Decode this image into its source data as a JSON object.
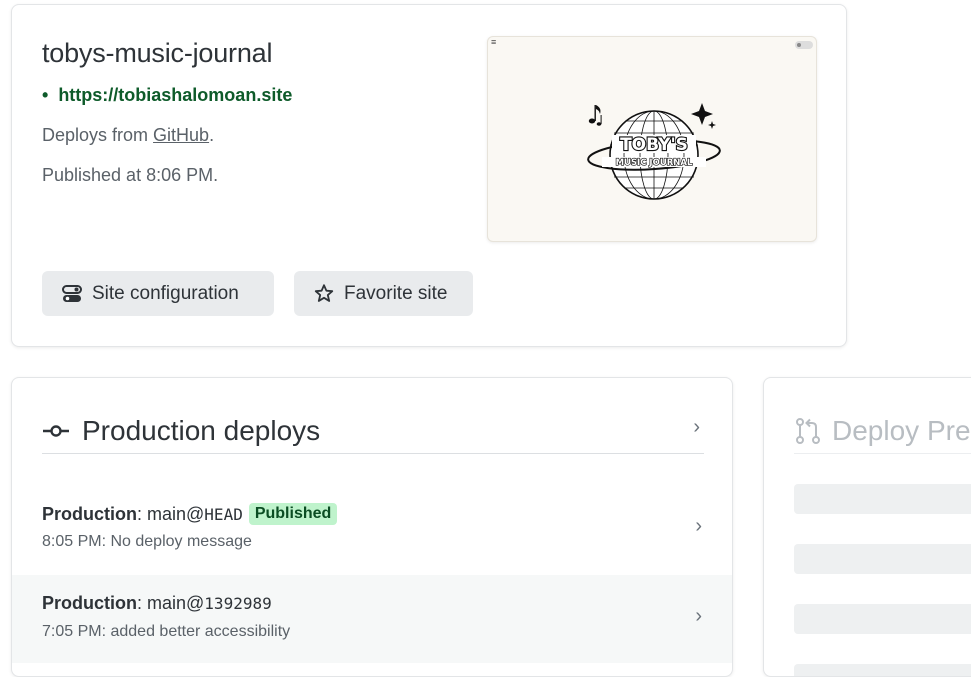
{
  "site": {
    "name": "tobys-music-journal",
    "url": "https://tobiashalomoan.site",
    "deploys_prefix": "Deploys from ",
    "deploys_link": "GitHub",
    "deploys_suffix": ".",
    "published": "Published at 8:06 PM."
  },
  "screenshot": {
    "logo_top_text": "TOBY'S",
    "logo_bottom_text": "MUSIC JOURNAL"
  },
  "actions": {
    "config_label": "Site configuration",
    "favorite_label": "Favorite site"
  },
  "production_deploys": {
    "title": "Production deploys",
    "items": [
      {
        "context": "Production",
        "ref_prefix": ": main@",
        "ref": "HEAD",
        "badge": "Published",
        "time_message": "8:05 PM: No deploy message"
      },
      {
        "context": "Production",
        "ref_prefix": ": main@",
        "ref": "1392989",
        "badge": "",
        "time_message": "7:05 PM: added better accessibility"
      }
    ]
  },
  "deploy_previews": {
    "title": "Deploy Pre"
  },
  "colors": {
    "url_green": "#0e5b2a",
    "badge_bg": "#bff3cc",
    "button_bg": "#e9ebed"
  }
}
